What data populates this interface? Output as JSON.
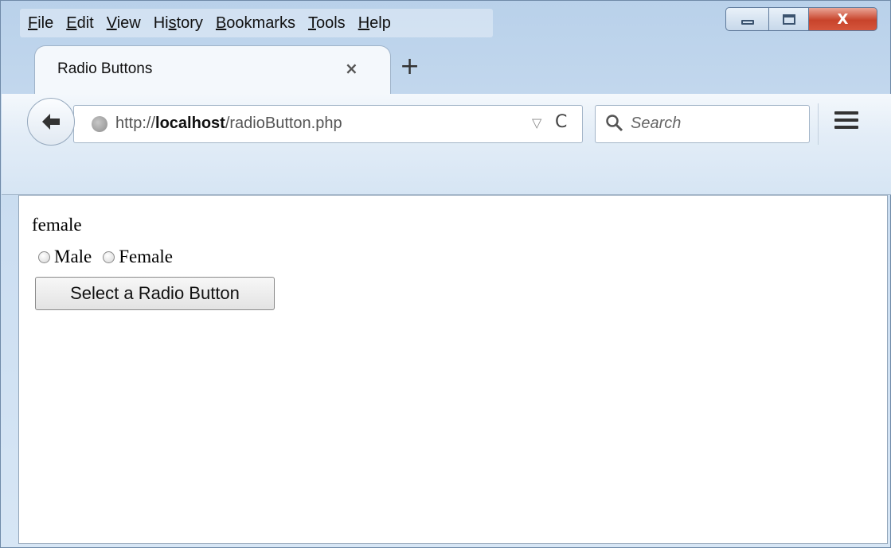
{
  "menu": {
    "items": [
      {
        "key": "F",
        "rest": "ile",
        "prefix": ""
      },
      {
        "key": "E",
        "rest": "dit",
        "prefix": ""
      },
      {
        "key": "V",
        "rest": "iew",
        "prefix": ""
      },
      {
        "key": "s",
        "rest": "tory",
        "prefix": "Hi"
      },
      {
        "key": "B",
        "rest": "ookmarks",
        "prefix": ""
      },
      {
        "key": "T",
        "rest": "ools",
        "prefix": ""
      },
      {
        "key": "H",
        "rest": "elp",
        "prefix": ""
      }
    ]
  },
  "window_controls": {
    "close_glyph": "X"
  },
  "tab": {
    "title": "Radio Buttons",
    "close_glyph": "×",
    "new_tab_glyph": "+"
  },
  "navbar": {
    "url_scheme": "http://",
    "url_host": "localhost",
    "url_path": "/radioButton.php",
    "dropmarker_glyph": "▽",
    "reload_glyph": "C",
    "search_placeholder": "Search"
  },
  "content": {
    "status_text": "female",
    "radios": [
      {
        "label": "Male",
        "checked": false
      },
      {
        "label": "Female",
        "checked": false
      }
    ],
    "button_label": "Select a Radio Button"
  },
  "colors": {
    "chrome_blue": "#d6e5f4",
    "close_red": "#c8432b",
    "content_bg": "#ffffff"
  }
}
